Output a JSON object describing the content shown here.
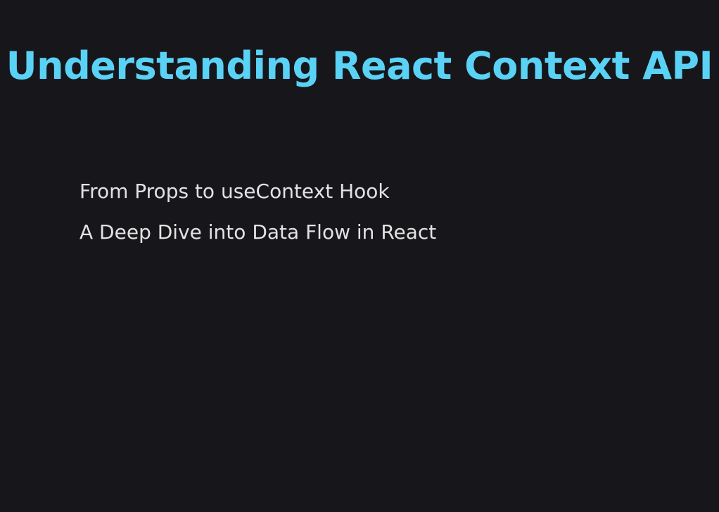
{
  "slide": {
    "title": "Understanding React Context API",
    "subtitle_lines": [
      "From Props to useContext Hook",
      "A Deep Dive into Data Flow in React"
    ]
  },
  "colors": {
    "background": "#17171b",
    "title": "#5ad2f5",
    "text": "#e2e2e2"
  }
}
